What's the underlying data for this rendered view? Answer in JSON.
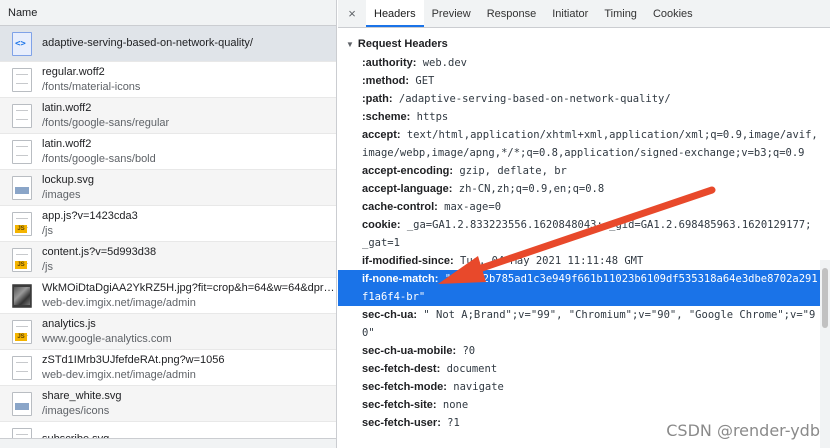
{
  "left": {
    "header": "Name",
    "rows": [
      {
        "name": "adaptive-serving-based-on-network-quality/",
        "path": "",
        "icon": "document-icon"
      },
      {
        "name": "regular.woff2",
        "path": "/fonts/material-icons",
        "icon": "font-file-icon"
      },
      {
        "name": "latin.woff2",
        "path": "/fonts/google-sans/regular",
        "icon": "font-file-icon"
      },
      {
        "name": "latin.woff2",
        "path": "/fonts/google-sans/bold",
        "icon": "font-file-icon"
      },
      {
        "name": "lockup.svg",
        "path": "/images",
        "icon": "image-file-icon"
      },
      {
        "name": "app.js?v=1423cda3",
        "path": "/js",
        "icon": "script-file-icon"
      },
      {
        "name": "content.js?v=5d993d38",
        "path": "/js",
        "icon": "script-file-icon"
      },
      {
        "name": "WkMOiDtaDgiAA2YkRZ5H.jpg?fit=crop&h=64&w=64&dpr=...",
        "path": "web-dev.imgix.net/image/admin",
        "icon": "photo-thumbnail-icon"
      },
      {
        "name": "analytics.js",
        "path": "www.google-analytics.com",
        "icon": "script-file-icon"
      },
      {
        "name": "zSTd1IMrb3UJfefdeRAt.png?w=1056",
        "path": "web-dev.imgix.net/image/admin",
        "icon": "font-file-icon"
      },
      {
        "name": "share_white.svg",
        "path": "/images/icons",
        "icon": "image-file-icon"
      },
      {
        "name": "subscribe.svg",
        "path": "",
        "icon": "font-file-icon"
      }
    ]
  },
  "tabs": {
    "close": "×",
    "items": [
      "Headers",
      "Preview",
      "Response",
      "Initiator",
      "Timing",
      "Cookies"
    ]
  },
  "headers": {
    "section": "Request Headers",
    "rows": [
      {
        "name": ":authority:",
        "value": " web.dev"
      },
      {
        "name": ":method:",
        "value": " GET"
      },
      {
        "name": ":path:",
        "value": " /adaptive-serving-based-on-network-quality/"
      },
      {
        "name": ":scheme:",
        "value": " https"
      },
      {
        "name": "accept:",
        "value": " text/html,application/xhtml+xml,application/xml;q=0.9,image/avif,image/webp,image/apng,*/*;q=0.8,application/signed-exchange;v=b3;q=0.9"
      },
      {
        "name": "accept-encoding:",
        "value": " gzip, deflate, br"
      },
      {
        "name": "accept-language:",
        "value": " zh-CN,zh;q=0.9,en;q=0.8"
      },
      {
        "name": "cache-control:",
        "value": " max-age=0"
      },
      {
        "name": "cookie:",
        "value": " _ga=GA1.2.833223556.1620848043; _gid=GA1.2.698485963.1620129177; _gat=1"
      },
      {
        "name": "if-modified-since:",
        "value": " Tue, 04 May 2021 11:11:48 GMT"
      },
      {
        "name": "if-none-match:",
        "value": " \"292a32b785ad1c3e949f661b11023b6109df535318a64e3dbe8702a291f1a6f4-br\""
      },
      {
        "name": "sec-ch-ua:",
        "value": " \" Not A;Brand\";v=\"99\", \"Chromium\";v=\"90\", \"Google Chrome\";v=\"90\""
      },
      {
        "name": "sec-ch-ua-mobile:",
        "value": " ?0"
      },
      {
        "name": "sec-fetch-dest:",
        "value": " document"
      },
      {
        "name": "sec-fetch-mode:",
        "value": " navigate"
      },
      {
        "name": "sec-fetch-site:",
        "value": " none"
      },
      {
        "name": "sec-fetch-user:",
        "value": " ?1"
      }
    ]
  },
  "colors": {
    "accent": "#1a73e8",
    "arrow": "#e8492b",
    "highlight_row": "#1a73e8"
  },
  "watermark": "CSDN @render-ydb"
}
